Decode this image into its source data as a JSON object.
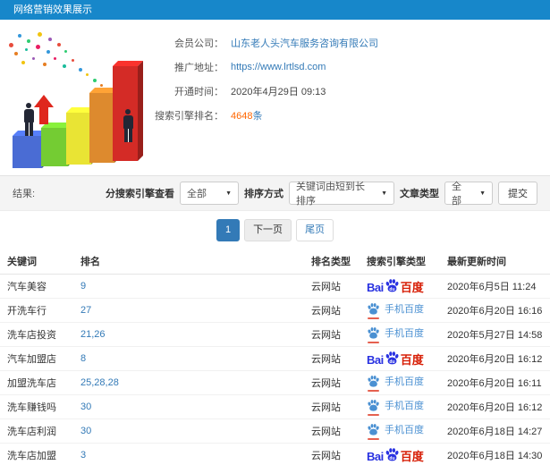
{
  "header": {
    "title": "网络营销效果展示"
  },
  "info": {
    "company_label": "会员公司：",
    "company_value": "山东老人头汽车服务咨询有限公司",
    "url_label": "推广地址：",
    "url_value": "https://www.lrtlsd.com",
    "open_time_label": "开通时间：",
    "open_time_value": "2020年4月29日 09:13",
    "rank_label": "搜索引擎排名：",
    "rank_count": "4648",
    "rank_unit": "条"
  },
  "filters": {
    "result_label": "结果:",
    "engine_label": "分搜索引擎查看",
    "engine_value": "全部",
    "sort_label": "排序方式",
    "sort_value": "关键词由短到长排序",
    "article_label": "文章类型",
    "article_value": "全部",
    "submit_label": "提交",
    "caret": "▼"
  },
  "pagination": {
    "current": "1",
    "next": "下一页",
    "last": "尾页"
  },
  "table": {
    "columns": [
      "关键词",
      "排名",
      "排名类型",
      "搜索引擎类型",
      "最新更新时间"
    ],
    "engine_logos": {
      "baidu": {
        "text_left": "Bai",
        "text_du": "du",
        "text_right": "百度"
      },
      "mobile_baidu": {
        "label": "手机百度"
      }
    },
    "rows": [
      {
        "keyword": "汽车美容",
        "rank": "9",
        "rank_type": "云网站",
        "engine": "baidu",
        "updated": "2020年6月5日 11:24"
      },
      {
        "keyword": "开洗车行",
        "rank": "27",
        "rank_type": "云网站",
        "engine": "mobile_baidu",
        "updated": "2020年6月20日 16:16"
      },
      {
        "keyword": "洗车店投资",
        "rank": "21,26",
        "rank_type": "云网站",
        "engine": "mobile_baidu",
        "updated": "2020年5月27日 14:58"
      },
      {
        "keyword": "汽车加盟店",
        "rank": "8",
        "rank_type": "云网站",
        "engine": "baidu",
        "updated": "2020年6月20日 16:12"
      },
      {
        "keyword": "加盟洗车店",
        "rank": "25,28,28",
        "rank_type": "云网站",
        "engine": "mobile_baidu",
        "updated": "2020年6月20日 16:11"
      },
      {
        "keyword": "洗车赚钱吗",
        "rank": "30",
        "rank_type": "云网站",
        "engine": "mobile_baidu",
        "updated": "2020年6月20日 16:12"
      },
      {
        "keyword": "洗车店利润",
        "rank": "30",
        "rank_type": "云网站",
        "engine": "mobile_baidu",
        "updated": "2020年6月18日 14:27"
      },
      {
        "keyword": "洗车店加盟",
        "rank": "3",
        "rank_type": "云网站",
        "engine": "baidu",
        "updated": "2020年6月18日 14:30"
      }
    ]
  },
  "colors": {
    "header_bg": "#1787ca",
    "link_blue": "#337ab7",
    "highlight_orange": "#ff6600",
    "baidu_blue": "#2932e1",
    "baidu_red": "#d71e06",
    "mobile_baidu_text": "#4a90d2",
    "bar_colors": [
      "#4a6cd4",
      "#74cc33",
      "#e9e434",
      "#dd8a2e",
      "#d42b26"
    ]
  }
}
